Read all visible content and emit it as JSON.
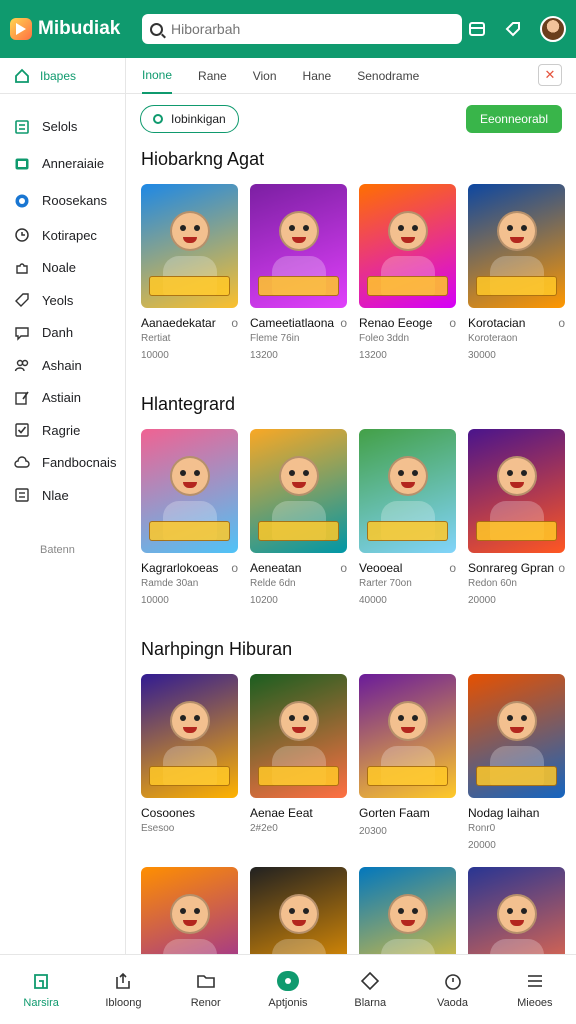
{
  "header": {
    "app_name": "Mibudiak",
    "search_placeholder": "Hiborarbah"
  },
  "sidebar": {
    "home_label": "Ibapes",
    "items": [
      {
        "label": "Selols",
        "icon": "grid-icon"
      },
      {
        "label": "Anneraiaie",
        "icon": "tv-icon"
      },
      {
        "label": "Roosekans",
        "icon": "globe-icon"
      },
      {
        "label": "Kotirapec",
        "icon": "clock-icon"
      },
      {
        "label": "Noale",
        "icon": "puzzle-icon"
      },
      {
        "label": "Yeols",
        "icon": "tag-icon"
      },
      {
        "label": "Danh",
        "icon": "chat-icon"
      },
      {
        "label": "Ashain",
        "icon": "people-icon"
      },
      {
        "label": "Astiain",
        "icon": "edit-icon"
      },
      {
        "label": "Ragrie",
        "icon": "check-icon"
      },
      {
        "label": "Fandbocnais",
        "icon": "cloud-icon"
      },
      {
        "label": "Nlae",
        "icon": "list-icon"
      }
    ],
    "footer_label": "Batenn"
  },
  "tabs": [
    "Inone",
    "Rane",
    "Vion",
    "Hane",
    "Senodrame"
  ],
  "filter": {
    "chip_label": "Iobinkigan",
    "cta_label": "Eeonneorabl"
  },
  "sections": [
    {
      "title": "Hiobarkng Agat",
      "cards": [
        {
          "title": "Aanaedekatar",
          "sub": "Rertiat",
          "num": "10000",
          "colors": [
            "#1e88e5",
            "#fbc02d"
          ]
        },
        {
          "title": "Cameetiatlaona",
          "sub": "Fleme 76in",
          "num": "13200",
          "colors": [
            "#7b1fa2",
            "#e040fb"
          ]
        },
        {
          "title": "Renao Eeoge",
          "sub": "Foleo 3ddn",
          "num": "13200",
          "colors": [
            "#ff6f00",
            "#d500f9"
          ]
        },
        {
          "title": "Korotacian",
          "sub": "Koroteraon",
          "num": "30000",
          "colors": [
            "#0d47a1",
            "#ff9800"
          ]
        }
      ]
    },
    {
      "title": "Hlantegrard",
      "cards": [
        {
          "title": "Kagrarlokoeas",
          "sub": "Ramde 30an",
          "num": "10000",
          "colors": [
            "#f06292",
            "#4fc3f7"
          ]
        },
        {
          "title": "Aeneatan",
          "sub": "Relde 6dn",
          "num": "10200",
          "colors": [
            "#f9a825",
            "#0097a7"
          ]
        },
        {
          "title": "Veooeal",
          "sub": "Rarter 70on",
          "num": "40000",
          "colors": [
            "#43a047",
            "#81d4fa"
          ]
        },
        {
          "title": "Sonrareg Gpran",
          "sub": "Redon 60n",
          "num": "20000",
          "colors": [
            "#4a148c",
            "#ff5722"
          ]
        }
      ]
    },
    {
      "title": "Narhpingn Hiburan",
      "cards": [
        {
          "title": "Cosoones",
          "sub": "Esesoo",
          "num": "",
          "colors": [
            "#311b92",
            "#ffb300"
          ]
        },
        {
          "title": "Aenae Eeat",
          "sub": "2#2e0",
          "num": "",
          "colors": [
            "#1b5e20",
            "#ff7043"
          ]
        },
        {
          "title": "Gorten Faam",
          "sub": "",
          "num": "20300",
          "colors": [
            "#6a1b9a",
            "#ffca28"
          ]
        },
        {
          "title": "Nodag Iaihan",
          "sub": "Ronr0",
          "num": "20000",
          "colors": [
            "#e65100",
            "#1565c0"
          ]
        }
      ]
    },
    {
      "title": "",
      "cards": [
        {
          "title": "",
          "sub": "",
          "num": "",
          "colors": [
            "#ff8f00",
            "#8e24aa"
          ]
        },
        {
          "title": "",
          "sub": "",
          "num": "",
          "colors": [
            "#212121",
            "#ffa000"
          ]
        },
        {
          "title": "",
          "sub": "",
          "num": "",
          "colors": [
            "#0277bd",
            "#ffca28"
          ]
        },
        {
          "title": "",
          "sub": "",
          "num": "",
          "colors": [
            "#283593",
            "#ff7043"
          ]
        }
      ]
    }
  ],
  "bottom_nav": [
    {
      "label": "Narsira",
      "icon": "home-icon",
      "active": true
    },
    {
      "label": "Ibloong",
      "icon": "upload-icon",
      "active": false
    },
    {
      "label": "Renor",
      "icon": "folder-icon",
      "active": false
    },
    {
      "label": "Aptjonis",
      "icon": "apps-icon",
      "active": false
    },
    {
      "label": "Blarna",
      "icon": "diamond-icon",
      "active": false
    },
    {
      "label": "Vaoda",
      "icon": "timer-icon",
      "active": false
    },
    {
      "label": "Mieoes",
      "icon": "menu-icon",
      "active": false
    }
  ],
  "colors": {
    "brand": "#0f9a6e",
    "cta": "#39b54a"
  }
}
